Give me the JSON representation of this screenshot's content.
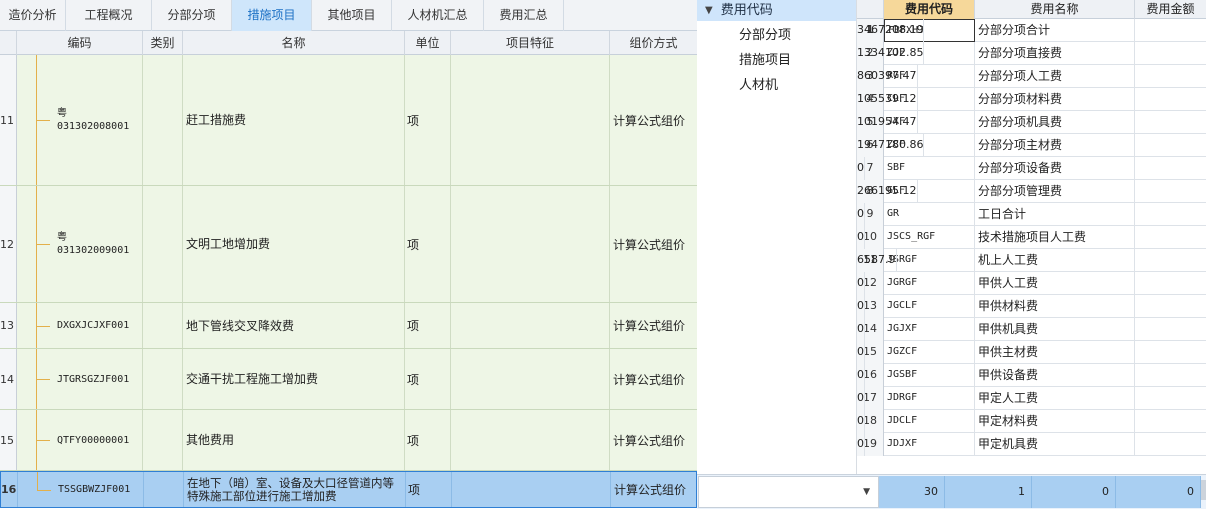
{
  "tabs": [
    {
      "label": "造价分析",
      "active": false
    },
    {
      "label": "工程概况",
      "active": false
    },
    {
      "label": "分部分项",
      "active": false
    },
    {
      "label": "措施项目",
      "active": true
    },
    {
      "label": "其他项目",
      "active": false
    },
    {
      "label": "人材机汇总",
      "active": false
    },
    {
      "label": "费用汇总",
      "active": false
    }
  ],
  "grid": {
    "headers": {
      "code": "编码",
      "type": "类别",
      "name": "名称",
      "unit": "单位",
      "feature": "项目特征",
      "mode": "组价方式"
    },
    "rows": [
      {
        "num": "11",
        "code_prefix": "粤",
        "code": "031302008001",
        "type": "",
        "name": "赶工措施费",
        "unit": "项",
        "feature": "",
        "mode": "计算公式组价"
      },
      {
        "num": "12",
        "code_prefix": "粤",
        "code": "031302009001",
        "type": "",
        "name": "文明工地增加费",
        "unit": "项",
        "feature": "",
        "mode": "计算公式组价"
      },
      {
        "num": "13",
        "code_prefix": "",
        "code": "DXGXJCJXF001",
        "type": "",
        "name": "地下管线交叉降效费",
        "unit": "项",
        "feature": "",
        "mode": "计算公式组价"
      },
      {
        "num": "14",
        "code_prefix": "",
        "code": "JTGRSGZJF001",
        "type": "",
        "name": "交通干扰工程施工增加费",
        "unit": "项",
        "feature": "",
        "mode": "计算公式组价"
      },
      {
        "num": "15",
        "code_prefix": "",
        "code": "QTFY00000001",
        "type": "",
        "name": "其他费用",
        "unit": "项",
        "feature": "",
        "mode": "计算公式组价"
      },
      {
        "num": "16",
        "code_prefix": "",
        "code": "TSSGBWZJF001",
        "type": "",
        "name": "在地下（暗）室、设备及大口径管道内等特殊施工部位进行施工增加费",
        "unit": "项",
        "feature": "",
        "mode": "计算公式组价",
        "selected": true
      }
    ]
  },
  "tree": {
    "root": "费用代码",
    "items": [
      "分部分项",
      "措施项目",
      "人材机"
    ]
  },
  "fee_table": {
    "headers": {
      "code": "费用代码",
      "name": "费用名称",
      "amount": "费用金额"
    },
    "rows": [
      {
        "n": "1",
        "code": "FBFXHJ",
        "name": "分部分项合计",
        "amount": "3467208.19"
      },
      {
        "n": "2",
        "code": "ZJF",
        "name": "分部分项直接费",
        "amount": "1334102.85"
      },
      {
        "n": "3",
        "code": "RGF",
        "name": "分部分项人工费",
        "amount": "860397.47"
      },
      {
        "n": "4",
        "code": "CLF",
        "name": "分部分项材料费",
        "amount": "105539.12"
      },
      {
        "n": "5",
        "code": "JXF",
        "name": "分部分项机具费",
        "amount": "101954.47"
      },
      {
        "n": "6",
        "code": "ZCF",
        "name": "分部分项主材费",
        "amount": "1947180.86"
      },
      {
        "n": "7",
        "code": "SBF",
        "name": "分部分项设备费",
        "amount": "0"
      },
      {
        "n": "8",
        "code": "GLF",
        "name": "分部分项管理费",
        "amount": "266195.12"
      },
      {
        "n": "9",
        "code": "GR",
        "name": "工日合计",
        "amount": "0"
      },
      {
        "n": "10",
        "code": "JSCS_RGF",
        "name": "技术措施项目人工费",
        "amount": "0"
      },
      {
        "n": "11",
        "code": "JSRGF",
        "name": "机上人工费",
        "amount": "6587.9"
      },
      {
        "n": "12",
        "code": "JGRGF",
        "name": "甲供人工费",
        "amount": "0"
      },
      {
        "n": "13",
        "code": "JGCLF",
        "name": "甲供材料费",
        "amount": "0"
      },
      {
        "n": "14",
        "code": "JGJXF",
        "name": "甲供机具费",
        "amount": "0"
      },
      {
        "n": "15",
        "code": "JGZCF",
        "name": "甲供主材费",
        "amount": "0"
      },
      {
        "n": "16",
        "code": "JGSBF",
        "name": "甲供设备费",
        "amount": "0"
      },
      {
        "n": "17",
        "code": "JDRGF",
        "name": "甲定人工费",
        "amount": "0"
      },
      {
        "n": "18",
        "code": "JDCLF",
        "name": "甲定材料费",
        "amount": "0"
      },
      {
        "n": "19",
        "code": "JDJXF",
        "name": "甲定机具费",
        "amount": "0"
      }
    ]
  },
  "editbar": {
    "dropdown_value": "",
    "values": [
      "30",
      "1",
      "0",
      "0"
    ]
  },
  "colors": {
    "active_tab": "#cfe6fb",
    "row_bg": "#eef6e6",
    "selected_row": "#a9cff2",
    "code_header": "#f6d89a",
    "tree_line": "#e3b04b"
  }
}
